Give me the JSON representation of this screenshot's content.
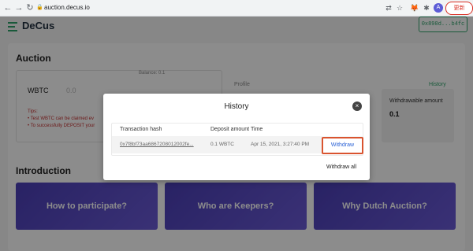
{
  "browser": {
    "back_icon": "←",
    "forward_icon": "→",
    "reload_icon": "↻",
    "url": "auction.decus.io",
    "avatar_initial": "A",
    "update_label": "更新"
  },
  "header": {
    "logo_text": "DeCus",
    "wallet": "0x890d...b4fc"
  },
  "auction": {
    "title": "Auction",
    "token": "WBTC",
    "amount_placeholder": "0.0",
    "balance": "Balance: 0.1",
    "tips_title": "Tips:",
    "tip1": "• Test WBTC can be claimed ev",
    "tip2": "• To successfully DEPOSIT your",
    "profile_label": "Profile",
    "history_link": "History",
    "withdrawable_label": "Withdrawable amount",
    "withdrawable_value": "0.1"
  },
  "intro": {
    "title": "Introduction",
    "tiles": [
      "How to participate?",
      "Who are Keepers?",
      "Why Dutch Auction?"
    ]
  },
  "modal": {
    "title": "History",
    "close_icon": "×",
    "columns": [
      "Transaction hash",
      "Deposit amount",
      "Time"
    ],
    "row": {
      "hash": "0x7f8bf73aa6867208012002fe...",
      "amount": "0.1 WBTC",
      "time": "Apr 15, 2021, 3:27:40 PM",
      "action": "Withdraw"
    },
    "withdraw_all": "Withdraw all"
  },
  "colors": {
    "accent": "#2fa36b",
    "link": "#2b62d6",
    "highlight": "#d9542f"
  }
}
